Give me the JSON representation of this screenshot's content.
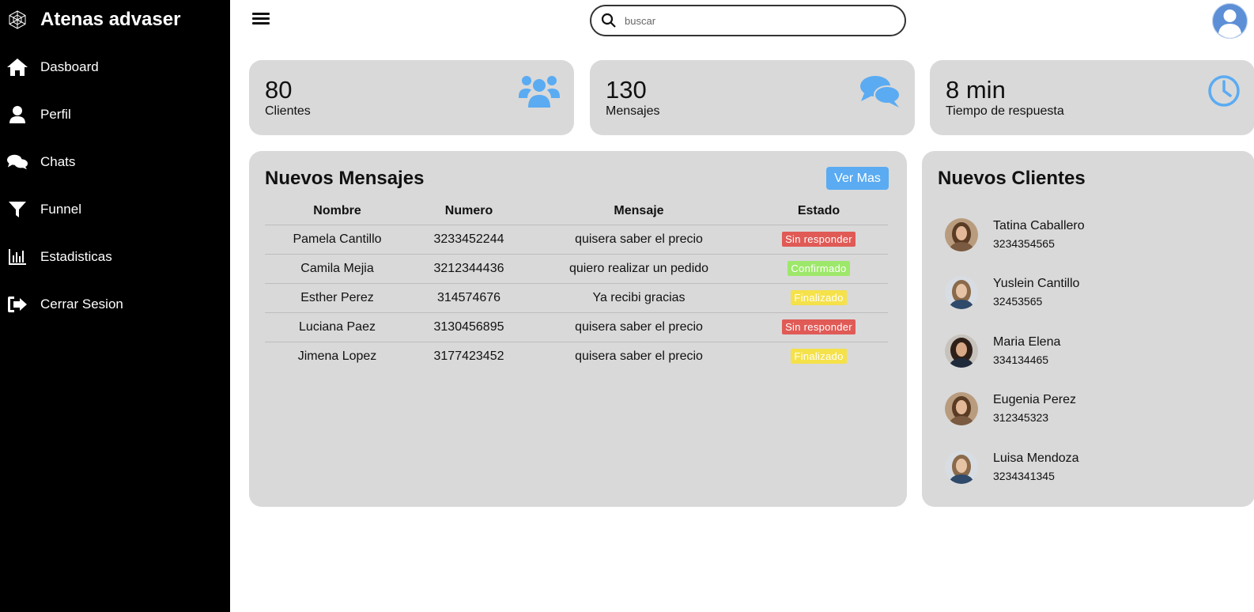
{
  "brand": {
    "title": "Atenas advaser",
    "logo_icon": "hexagon-logo-icon"
  },
  "sidebar": {
    "items": [
      {
        "label": "Dasboard",
        "icon": "home-icon"
      },
      {
        "label": "Perfil",
        "icon": "user-icon"
      },
      {
        "label": "Chats",
        "icon": "chat-bubbles-icon"
      },
      {
        "label": "Funnel",
        "icon": "funnel-icon"
      },
      {
        "label": "Estadisticas",
        "icon": "bar-chart-icon"
      },
      {
        "label": "Cerrar Sesion",
        "icon": "sign-out-icon"
      }
    ]
  },
  "search": {
    "placeholder": "buscar",
    "value": ""
  },
  "stats": [
    {
      "value": "80",
      "label": "Clientes",
      "icon": "users-icon"
    },
    {
      "value": "130",
      "label": "Mensajes",
      "icon": "comments-icon"
    },
    {
      "value": "8 min",
      "label": "Tiempo de respuesta",
      "icon": "clock-icon"
    }
  ],
  "colors": {
    "accent": "#5aabf2",
    "card": "#d9d9d9",
    "sin_responder": "#e05a56",
    "confirmado": "#9de86a",
    "finalizado": "#f5e14a"
  },
  "messages": {
    "title": "Nuevos Mensajes",
    "button": "Ver Mas",
    "headers": [
      "Nombre",
      "Numero",
      "Mensaje",
      "Estado"
    ],
    "rows": [
      {
        "name": "Pamela Cantillo",
        "number": "3233452244",
        "message": "quisera saber el precio",
        "status": "Sin responder",
        "status_color": "#e05a56"
      },
      {
        "name": "Camila Mejia",
        "number": "3212344436",
        "message": "quiero realizar un pedido",
        "status": "Confirmado",
        "status_color": "#9de86a"
      },
      {
        "name": "Esther Perez",
        "number": "314574676",
        "message": "Ya recibi gracias",
        "status": "Finalizado",
        "status_color": "#f5e14a"
      },
      {
        "name": "Luciana Paez",
        "number": "3130456895",
        "message": "quisera saber el precio",
        "status": "Sin responder",
        "status_color": "#e05a56"
      },
      {
        "name": "Jimena Lopez",
        "number": "3177423452",
        "message": "quisera saber el precio",
        "status": "Finalizado",
        "status_color": "#f5e14a"
      }
    ]
  },
  "clients": {
    "title": "Nuevos Clientes",
    "items": [
      {
        "name": "Tatina Caballero",
        "phone": "3234354565"
      },
      {
        "name": "Yuslein Cantillo",
        "phone": "32453565"
      },
      {
        "name": "Maria Elena",
        "phone": "334134465"
      },
      {
        "name": "Eugenia Perez",
        "phone": "312345323"
      },
      {
        "name": "Luisa Mendoza",
        "phone": "3234341345"
      }
    ]
  }
}
